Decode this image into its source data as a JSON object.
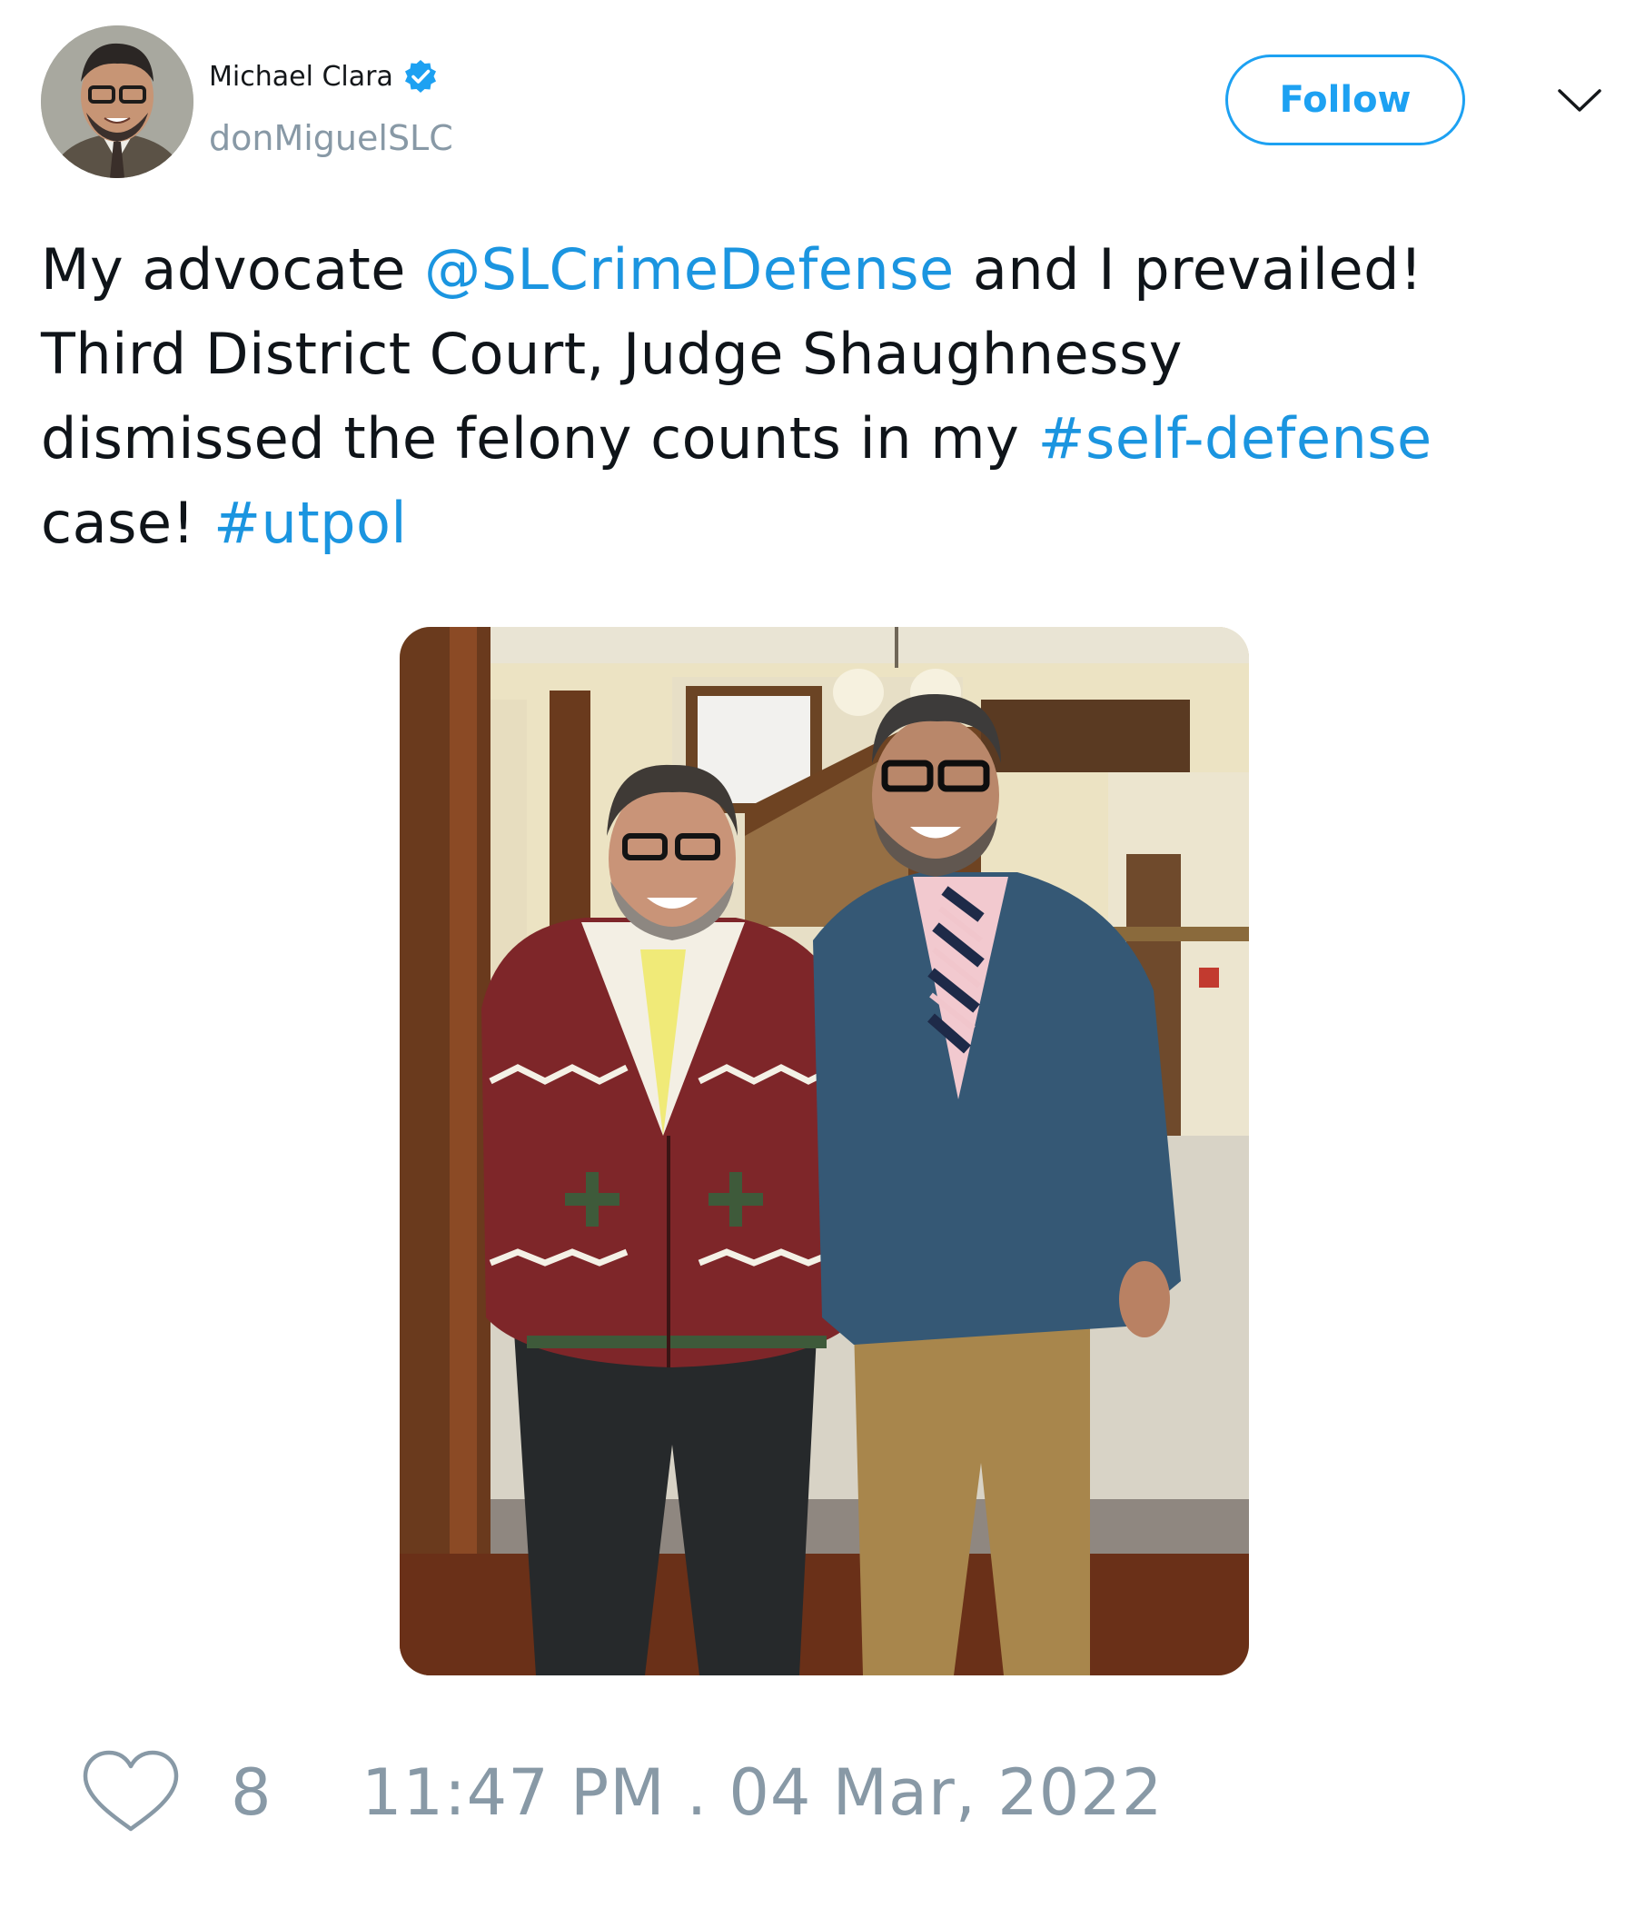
{
  "author": {
    "display_name": "Michael Clara",
    "handle": "donMiguelSLC",
    "verified": true
  },
  "actions": {
    "follow_label": "Follow"
  },
  "tweet": {
    "lines": [
      [
        {
          "text": "My advocate ",
          "type": "text"
        },
        {
          "text": "@SLCrimeDefense",
          "type": "mention"
        },
        {
          "text": " and I prevailed!",
          "type": "text"
        }
      ],
      [
        {
          "text": "Third District Court, Judge Shaughnessy",
          "type": "text"
        }
      ],
      [
        {
          "text": "dismissed the felony counts in my ",
          "type": "text"
        },
        {
          "text": "#self-defense",
          "type": "hashtag"
        }
      ],
      [
        {
          "text": "case! ",
          "type": "text"
        },
        {
          "text": "#utpol",
          "type": "hashtag"
        }
      ]
    ]
  },
  "footer": {
    "like_count": "8",
    "timestamp": "11:47 PM . 04 Mar, 2022"
  },
  "colors": {
    "accent": "#1da1f2",
    "link": "#1b95e0",
    "muted": "#8899a6",
    "text": "#0f1419"
  },
  "icons": {
    "verified": "verified-badge-icon",
    "menu": "chevron-down-icon",
    "like": "heart-icon"
  }
}
